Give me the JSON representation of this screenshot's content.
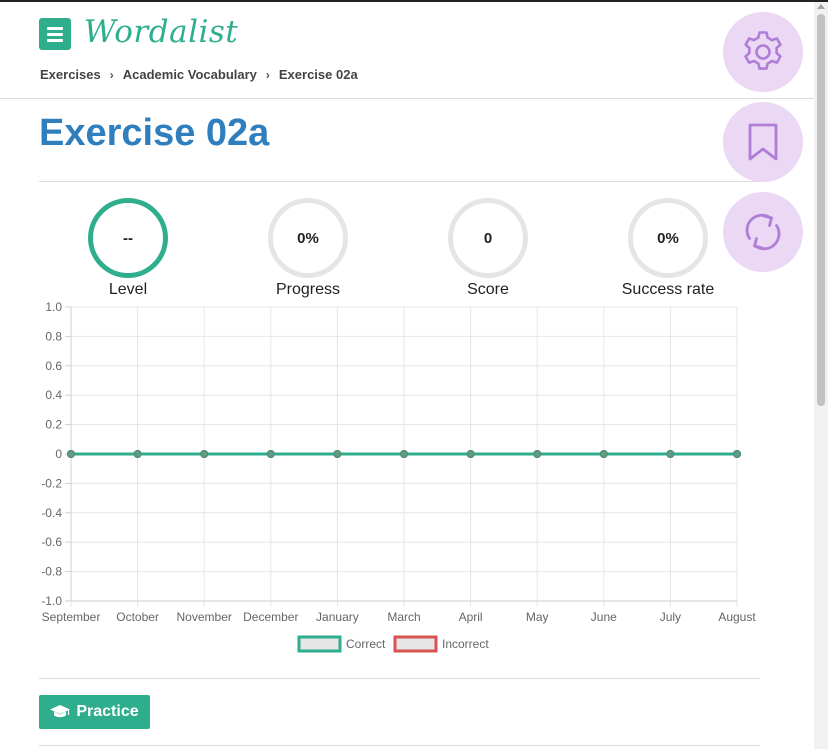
{
  "app": {
    "name": "Wordalist"
  },
  "breadcrumb": [
    "Exercises",
    "Academic Vocabulary",
    "Exercise 02a"
  ],
  "page": {
    "title": "Exercise 02a"
  },
  "stats": [
    {
      "value": "--",
      "label": "Level"
    },
    {
      "value": "0%",
      "label": "Progress"
    },
    {
      "value": "0",
      "label": "Score"
    },
    {
      "value": "0%",
      "label": "Success rate"
    }
  ],
  "actions": {
    "practice_label": "Practice"
  },
  "fab_icons": [
    "gear-icon",
    "bookmark-icon",
    "refresh-icon"
  ],
  "colors": {
    "accent": "#2fae8e",
    "title": "#2f7fbf",
    "fab_bg": "#ead8f4",
    "fab_icon": "#b07ed6",
    "incorrect": "#d9534f"
  },
  "chart_data": {
    "type": "line",
    "categories": [
      "September",
      "October",
      "November",
      "December",
      "January",
      "March",
      "April",
      "May",
      "June",
      "July",
      "August"
    ],
    "series": [
      {
        "name": "Correct",
        "values": [
          0,
          0,
          0,
          0,
          0,
          0,
          0,
          0,
          0,
          0,
          0
        ],
        "color": "#2fae8e"
      },
      {
        "name": "Incorrect",
        "values": [
          0,
          0,
          0,
          0,
          0,
          0,
          0,
          0,
          0,
          0,
          0
        ],
        "color": "#d9534f"
      }
    ],
    "yticks": [
      "1.0",
      "0.8",
      "0.6",
      "0.4",
      "0.2",
      "0",
      "-0.2",
      "-0.4",
      "-0.6",
      "-0.8",
      "-1.0"
    ],
    "ylim": [
      -1,
      1
    ],
    "grid": true,
    "legend": "bottom"
  }
}
